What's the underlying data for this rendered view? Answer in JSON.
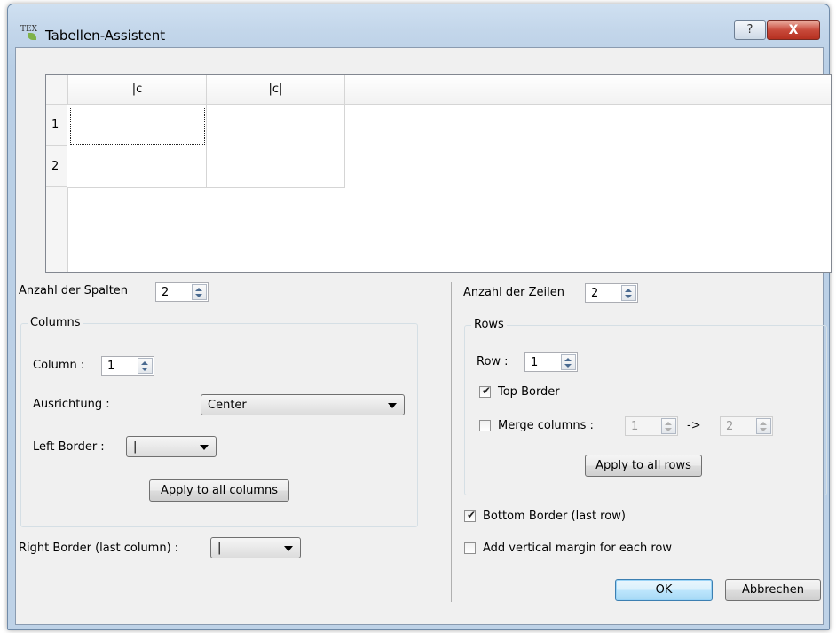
{
  "window": {
    "title": "Tabellen-Assistent",
    "help_label": "?",
    "close_label": "X"
  },
  "grid": {
    "columns": [
      "|c",
      "|c|"
    ],
    "rows": [
      "1",
      "2"
    ]
  },
  "left": {
    "cols_label": "Anzahl der Spalten",
    "cols_value": "2",
    "group_title": "Columns",
    "column_label": "Column :",
    "column_value": "1",
    "align_label": "Ausrichtung :",
    "align_value": "Center",
    "left_border_label": "Left Border :",
    "left_border_value": "|",
    "apply_cols_label": "Apply to all columns",
    "right_border_label": "Right Border (last column) :",
    "right_border_value": "|"
  },
  "right": {
    "rows_label": "Anzahl der Zeilen",
    "rows_value": "2",
    "group_title": "Rows",
    "row_label": "Row :",
    "row_value": "1",
    "top_border_label": "Top Border",
    "top_border_checked": true,
    "merge_label": "Merge columns :",
    "merge_checked": false,
    "merge_from": "1",
    "merge_arrow": "->",
    "merge_to": "2",
    "apply_rows_label": "Apply to all rows",
    "bottom_border_label": "Bottom Border (last row)",
    "bottom_border_checked": true,
    "vmargin_label": "Add vertical margin for each row",
    "vmargin_checked": false
  },
  "footer": {
    "ok_label": "OK",
    "cancel_label": "Abbrechen"
  }
}
